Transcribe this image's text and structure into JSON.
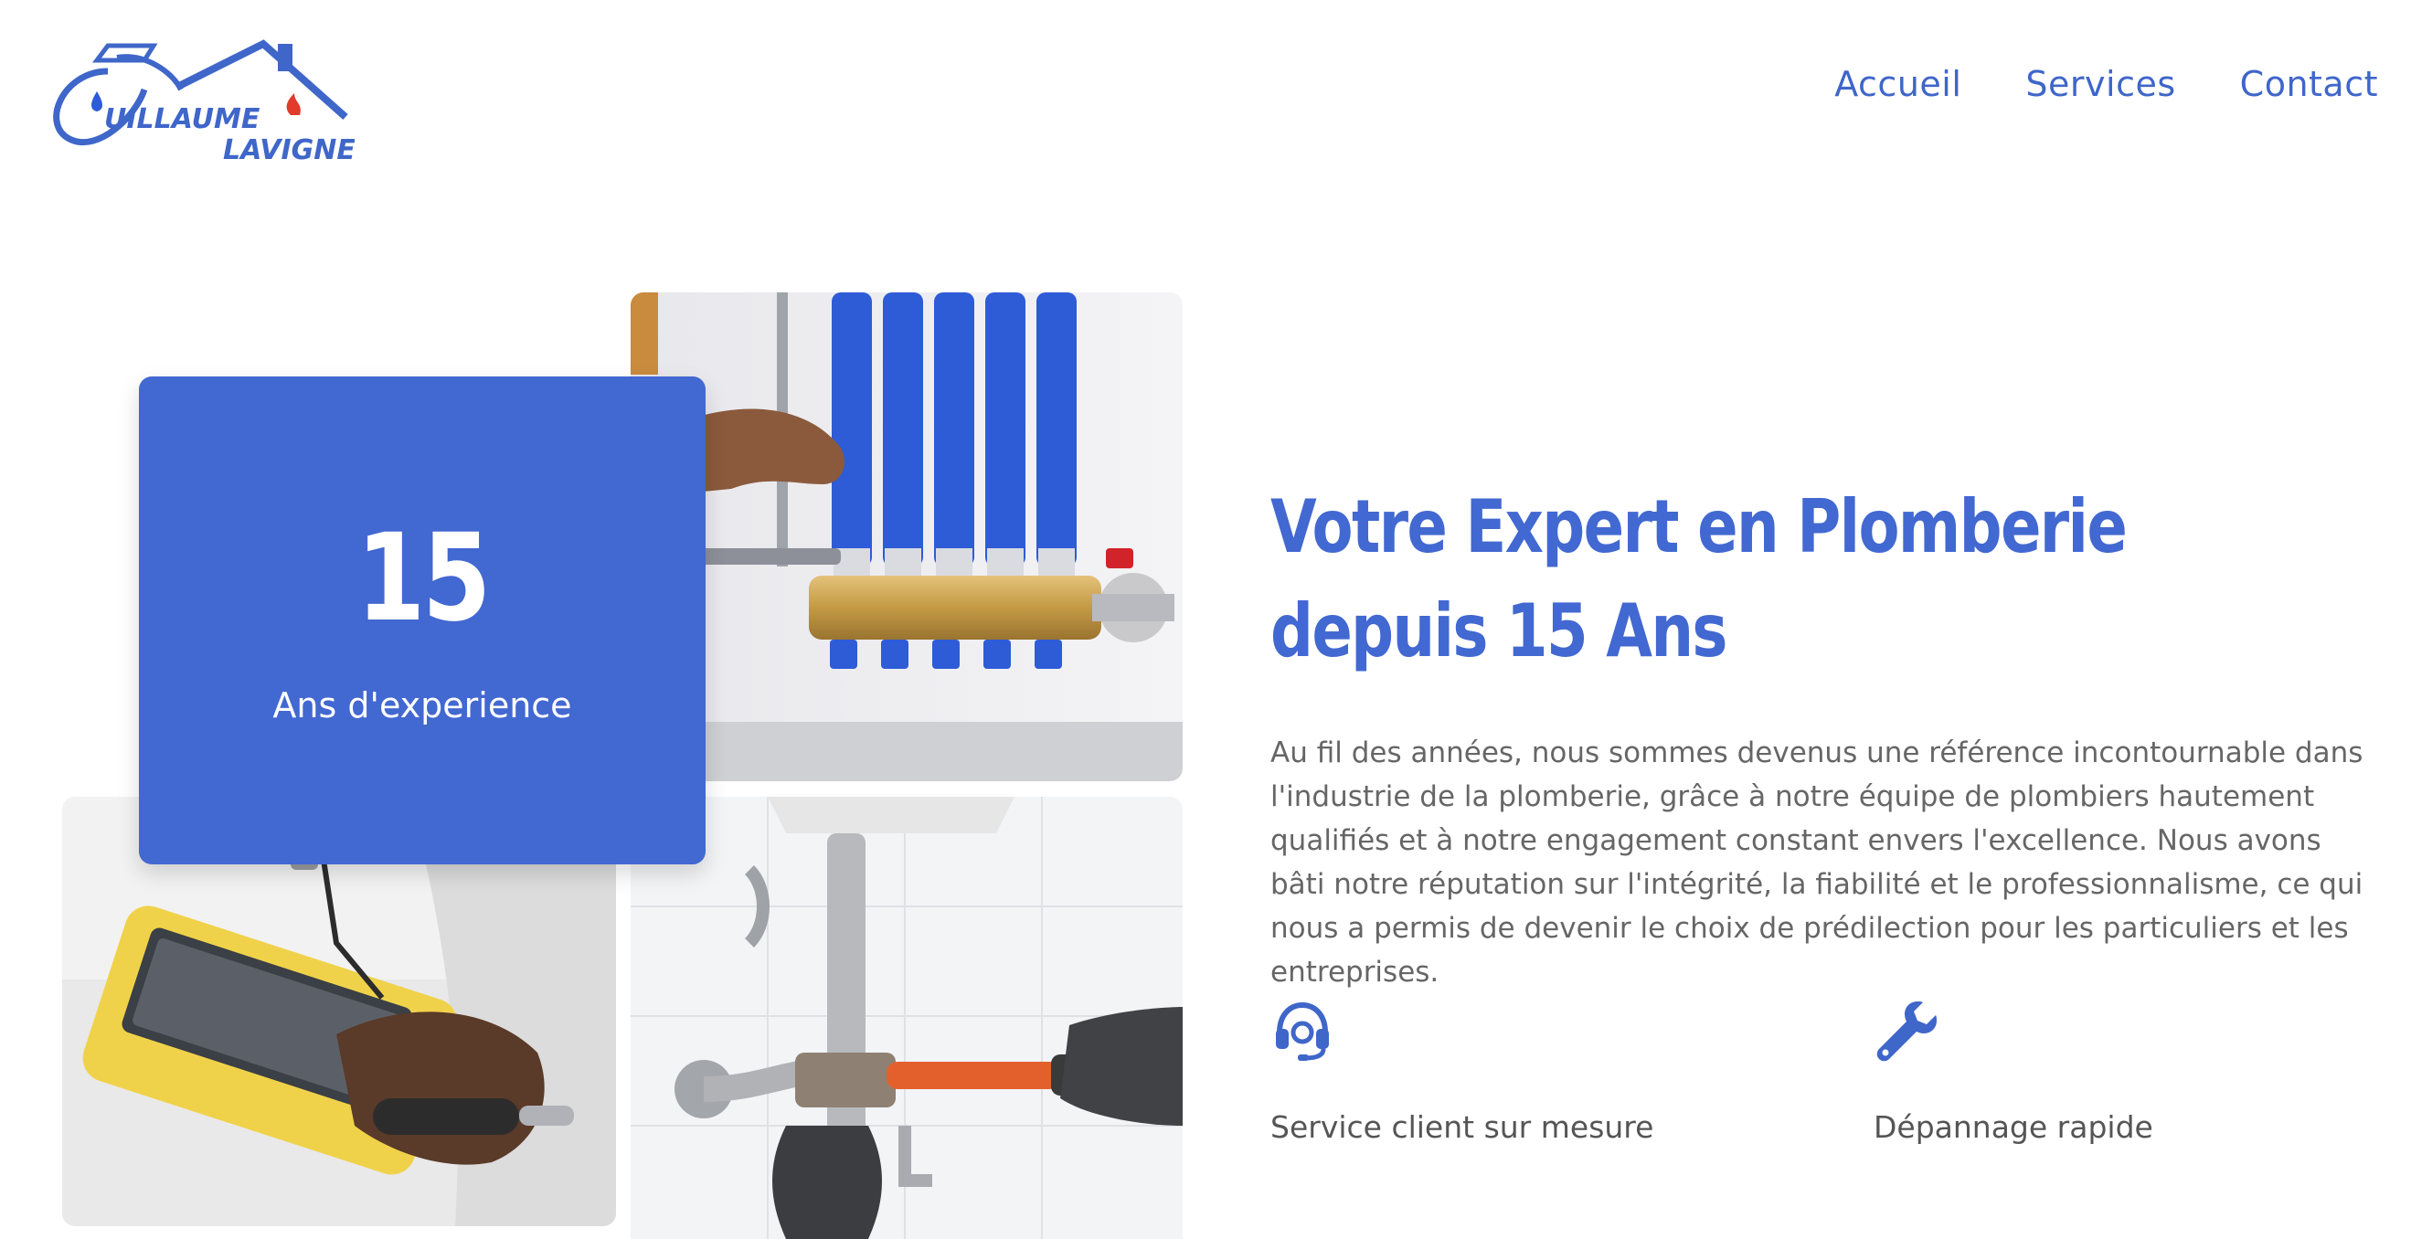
{
  "brand": {
    "logo_line1": "UILLAUME",
    "logo_line2": "LAVIGNE",
    "colors": {
      "primary": "#4268d1",
      "drop": "#2e5bd6",
      "flame": "#e23b2b"
    }
  },
  "nav": {
    "items": [
      {
        "label": "Accueil"
      },
      {
        "label": "Services"
      },
      {
        "label": "Contact"
      }
    ]
  },
  "experience": {
    "number": "15",
    "label": "Ans d'experience"
  },
  "hero": {
    "title": "Votre Expert en Plomberie depuis 15 Ans",
    "body": "Au fil des années, nous sommes devenus une référence incontournable dans l'industrie de la plomberie, grâce à notre équipe de plombiers hautement qualifiés et à notre engagement constant envers l'excellence. Nous avons bâti notre réputation sur l'intégrité, la fiabilité et le professionnalisme, ce qui nous a permis de devenir le choix de prédilection pour les particuliers et les entreprises."
  },
  "features": [
    {
      "icon": "headset-icon",
      "label": "Service client sur mesure"
    },
    {
      "icon": "wrench-icon",
      "label": "Dépannage rapide"
    }
  ]
}
